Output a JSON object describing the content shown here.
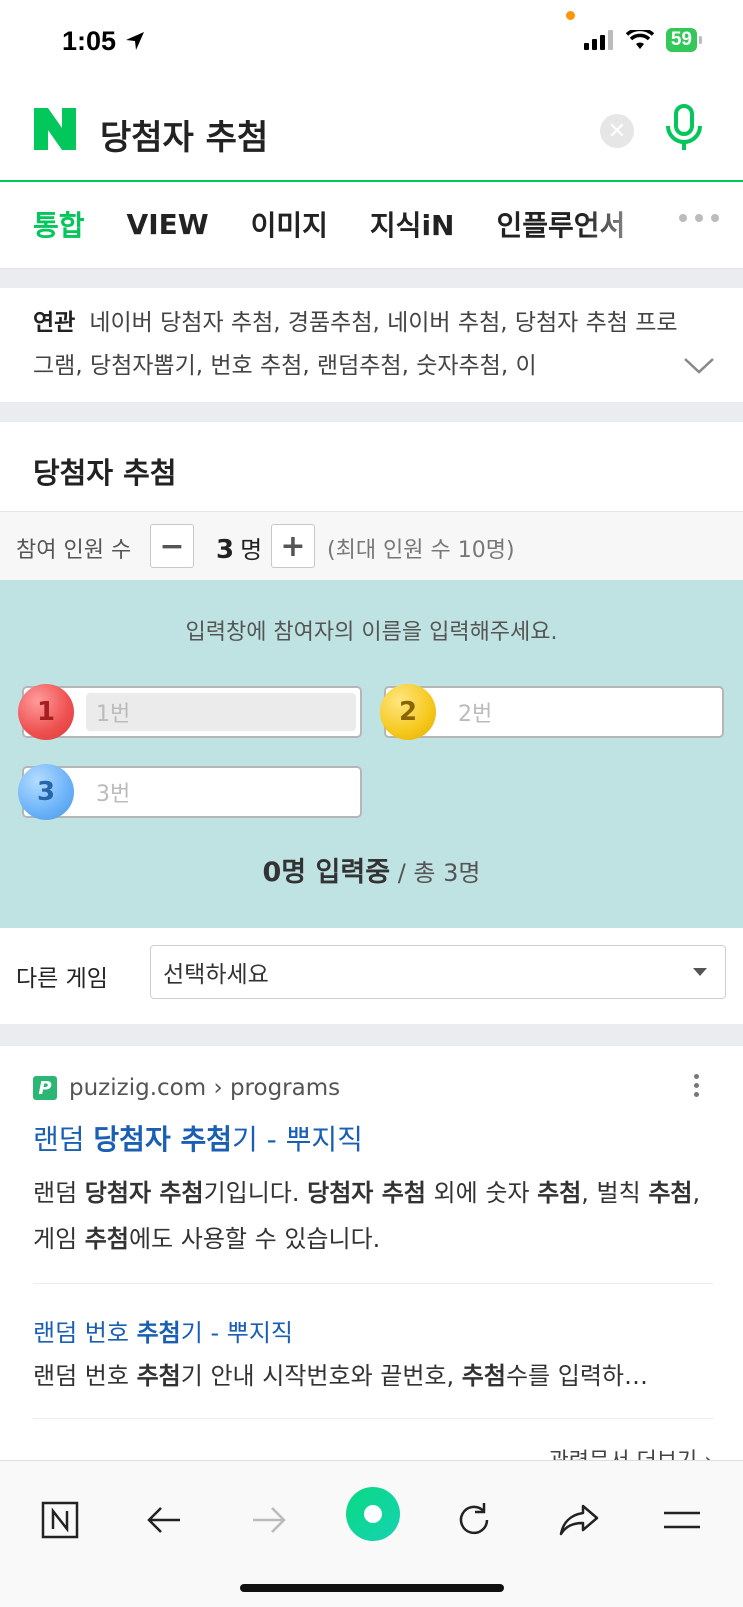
{
  "status_bar": {
    "time": "1:05",
    "battery": "59"
  },
  "search": {
    "logo": "N",
    "query": "당첨자 추첨",
    "clear_icon": "clear-icon",
    "mic_icon": "mic-icon"
  },
  "tabs": [
    {
      "label": "통합",
      "active": true
    },
    {
      "label": "VIEW"
    },
    {
      "label": "이미지"
    },
    {
      "label": "지식iN"
    },
    {
      "label": "인플루언서"
    }
  ],
  "related": {
    "label": "연관",
    "text": "네이버 당첨자 추첨, 경품추첨, 네이버 추첨, 당첨자 추첨 프로그램, 당첨자뽑기, 번호 추첨, 랜덤추첨, 숫자추첨, 이"
  },
  "widget": {
    "title": "당첨자 추첨",
    "count_label": "참여 인원 수",
    "minus": "−",
    "plus": "+",
    "count_number": "3",
    "count_unit": "명",
    "max_note": "(최대 인원 수 10명)",
    "instruction": "입력창에 참여자의 이름을 입력해주세요.",
    "participants": [
      {
        "number": "1",
        "placeholder": "1번",
        "color": "#ee4f4f"
      },
      {
        "number": "2",
        "placeholder": "2번",
        "color": "#f6c81c"
      },
      {
        "number": "3",
        "placeholder": "3번",
        "color": "#6ab2f8"
      }
    ],
    "status_entered": "0명 입력중",
    "status_total": " / 총 3명",
    "other_game_label": "다른 게임",
    "other_game_value": "선택하세요"
  },
  "result": {
    "favicon": "P",
    "source": "puzizig.com › programs",
    "title_pre": "랜덤 ",
    "title_bold": "당첨자 추첨",
    "title_post": "기 - 뿌지직",
    "desc_parts": [
      "랜덤 ",
      "당첨자 추첨",
      "기입니다. ",
      "당첨자 추첨",
      " 외에 숫자 ",
      "추첨",
      ", 벌칙 ",
      "추첨",
      ", 게임 ",
      "추첨",
      "에도 사용할 수 있습니다."
    ],
    "sub_title_pre": "랜덤 번호 ",
    "sub_title_bold": "추첨",
    "sub_title_post": "기 - 뿌지직",
    "sub_desc_parts": [
      "랜덤 번호 ",
      "추첨",
      "기 안내 시작번호와 끝번호, ",
      "추첨",
      "수를 입력하…"
    ],
    "more_docs": "관련문서 더보기 ›"
  },
  "bottom_nav": [
    "naver-home-icon",
    "back-arrow-icon",
    "forward-arrow-icon",
    "green-home-button",
    "refresh-icon",
    "share-icon",
    "menu-icon"
  ],
  "colors": {
    "accent": "#03c75a",
    "link": "#1a5fb4",
    "panel": "#bfe3e2"
  }
}
